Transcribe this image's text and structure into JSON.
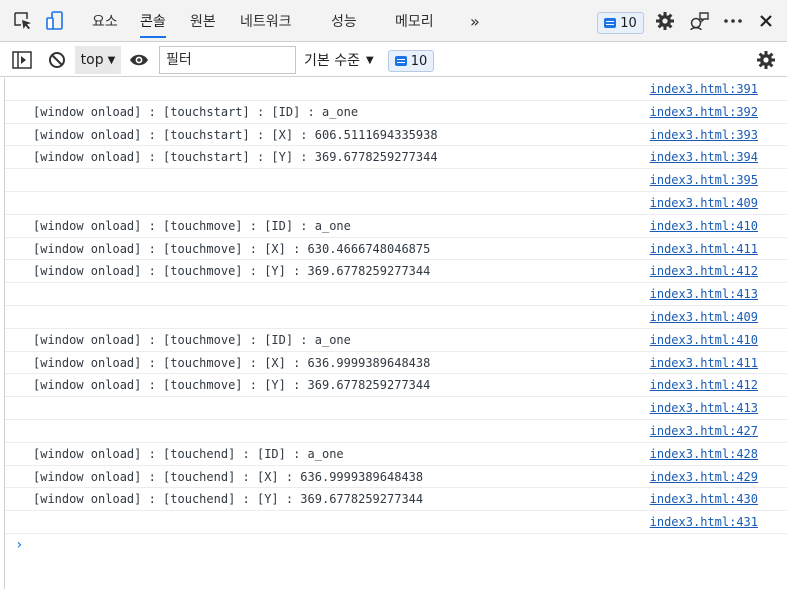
{
  "tabs": [
    {
      "label": "요소"
    },
    {
      "label": "콘솔"
    },
    {
      "label": "원본"
    },
    {
      "label": "네트워크"
    },
    {
      "label": "성능"
    },
    {
      "label": "메모리"
    }
  ],
  "more_tabs": "»",
  "issues_count": "10",
  "toolbar": {
    "context": "top",
    "filter_placeholder": "필터",
    "levels": "기본 수준",
    "messages_count": "10"
  },
  "console_rows": [
    {
      "msg": "",
      "src": "index3.html:391"
    },
    {
      "msg": "[window onload] : [touchstart] : [ID] : a_one",
      "src": "index3.html:392"
    },
    {
      "msg": "[window onload] : [touchstart] : [X] : 606.5111694335938",
      "src": "index3.html:393"
    },
    {
      "msg": "[window onload] : [touchstart] : [Y] : 369.6778259277344",
      "src": "index3.html:394"
    },
    {
      "msg": "",
      "src": "index3.html:395"
    },
    {
      "msg": "",
      "src": "index3.html:409"
    },
    {
      "msg": "[window onload] : [touchmove] : [ID] : a_one",
      "src": "index3.html:410"
    },
    {
      "msg": "[window onload] : [touchmove] : [X] : 630.4666748046875",
      "src": "index3.html:411"
    },
    {
      "msg": "[window onload] : [touchmove] : [Y] : 369.6778259277344",
      "src": "index3.html:412"
    },
    {
      "msg": "",
      "src": "index3.html:413"
    },
    {
      "msg": "",
      "src": "index3.html:409"
    },
    {
      "msg": "[window onload] : [touchmove] : [ID] : a_one",
      "src": "index3.html:410"
    },
    {
      "msg": "[window onload] : [touchmove] : [X] : 636.9999389648438",
      "src": "index3.html:411"
    },
    {
      "msg": "[window onload] : [touchmove] : [Y] : 369.6778259277344",
      "src": "index3.html:412"
    },
    {
      "msg": "",
      "src": "index3.html:413"
    },
    {
      "msg": "",
      "src": "index3.html:427"
    },
    {
      "msg": "[window onload] : [touchend] : [ID] : a_one",
      "src": "index3.html:428"
    },
    {
      "msg": "[window onload] : [touchend] : [X] : 636.9999389648438",
      "src": "index3.html:429"
    },
    {
      "msg": "[window onload] : [touchend] : [Y] : 369.6778259277344",
      "src": "index3.html:430"
    },
    {
      "msg": "",
      "src": "index3.html:431"
    }
  ],
  "prompt_symbol": "›",
  "colors": {
    "accent": "#1a73e8",
    "link": "#1a5bb5",
    "toolbar_bg": "#f3f3f3"
  }
}
